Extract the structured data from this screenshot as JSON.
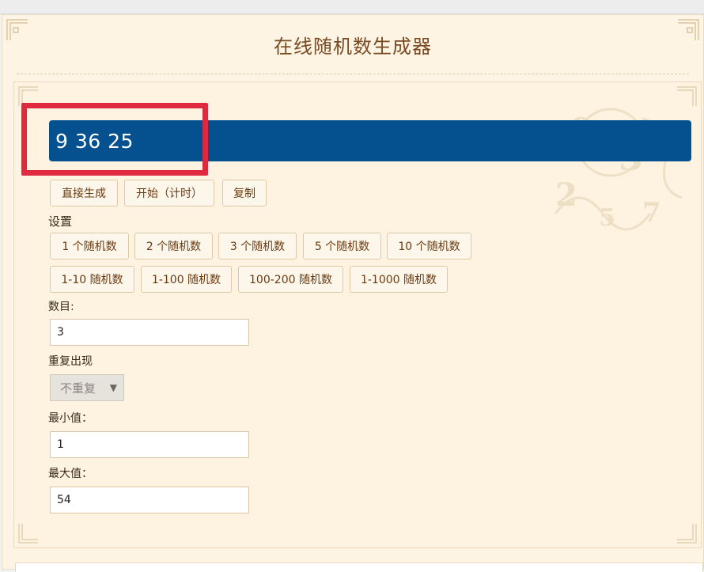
{
  "header": {
    "title": "在线随机数生成器"
  },
  "result": {
    "value": "9 36 25"
  },
  "actions": {
    "generate_label": "直接生成",
    "start_timer_label": "开始（计时）",
    "copy_label": "复制"
  },
  "settings": {
    "heading": "设置",
    "count_presets": [
      "1 个随机数",
      "2 个随机数",
      "3 个随机数",
      "5 个随机数",
      "10 个随机数"
    ],
    "range_presets": [
      "1-10 随机数",
      "1-100 随机数",
      "100-200 随机数",
      "1-1000 随机数"
    ],
    "count_label": "数目:",
    "count_value": "3",
    "repeat_label": "重复出现",
    "repeat_selected": "不重复",
    "min_label": "最小值：",
    "min_value": "1",
    "max_label": "最大值：",
    "max_value": "54"
  },
  "colors": {
    "result_bar": "#05508f",
    "highlight": "#e0283e",
    "button_text": "#6a3b12",
    "background": "#fdf4e3"
  },
  "icons": [
    "corner-ornament-icon",
    "number-watermark-icon",
    "dropdown-arrow-icon"
  ]
}
